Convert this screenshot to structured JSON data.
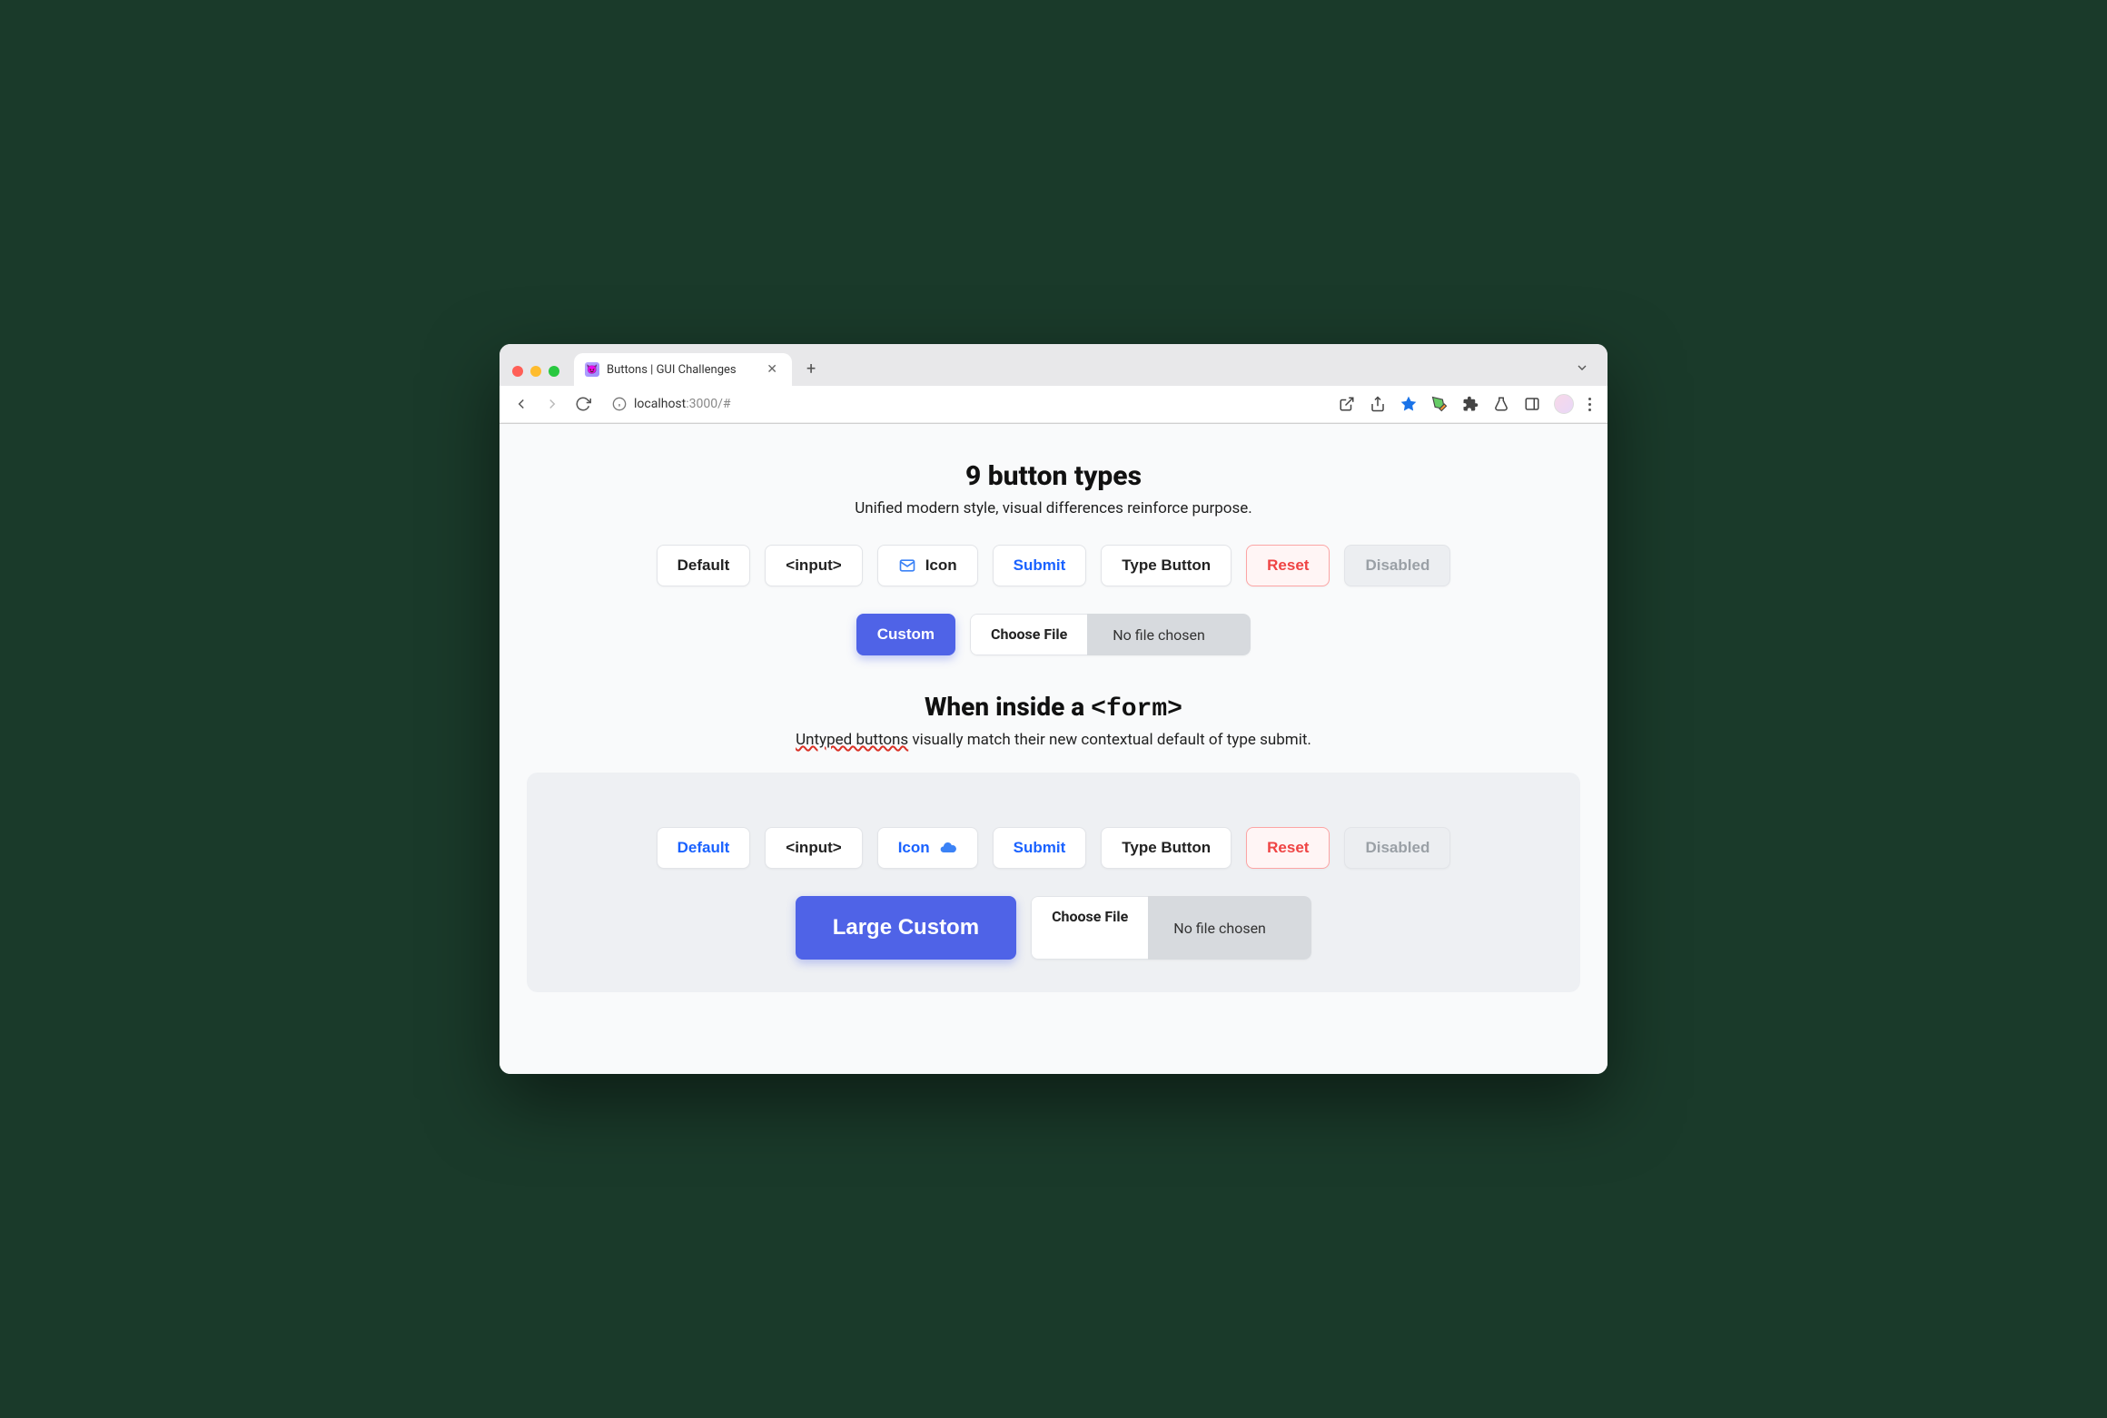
{
  "browser": {
    "tab_title": "Buttons | GUI Challenges",
    "url_host": "localhost",
    "url_port": ":3000",
    "url_path": "/#"
  },
  "section1": {
    "title": "9 button types",
    "subtitle": "Unified modern style, visual differences reinforce purpose.",
    "buttons": {
      "default": "Default",
      "input": "<input>",
      "icon": "Icon",
      "submit": "Submit",
      "type_button": "Type Button",
      "reset": "Reset",
      "disabled": "Disabled",
      "custom": "Custom",
      "choose_file": "Choose File",
      "file_status": "No file chosen"
    }
  },
  "section2": {
    "title_prefix": "When inside a ",
    "title_code": "<form>",
    "subtitle_squiggle": "Untyped buttons",
    "subtitle_rest": " visually match their new contextual default of type submit.",
    "buttons": {
      "default": "Default",
      "input": "<input>",
      "icon": "Icon",
      "submit": "Submit",
      "type_button": "Type Button",
      "reset": "Reset",
      "disabled": "Disabled",
      "large_custom": "Large Custom",
      "choose_file": "Choose File",
      "file_status": "No file chosen"
    }
  }
}
